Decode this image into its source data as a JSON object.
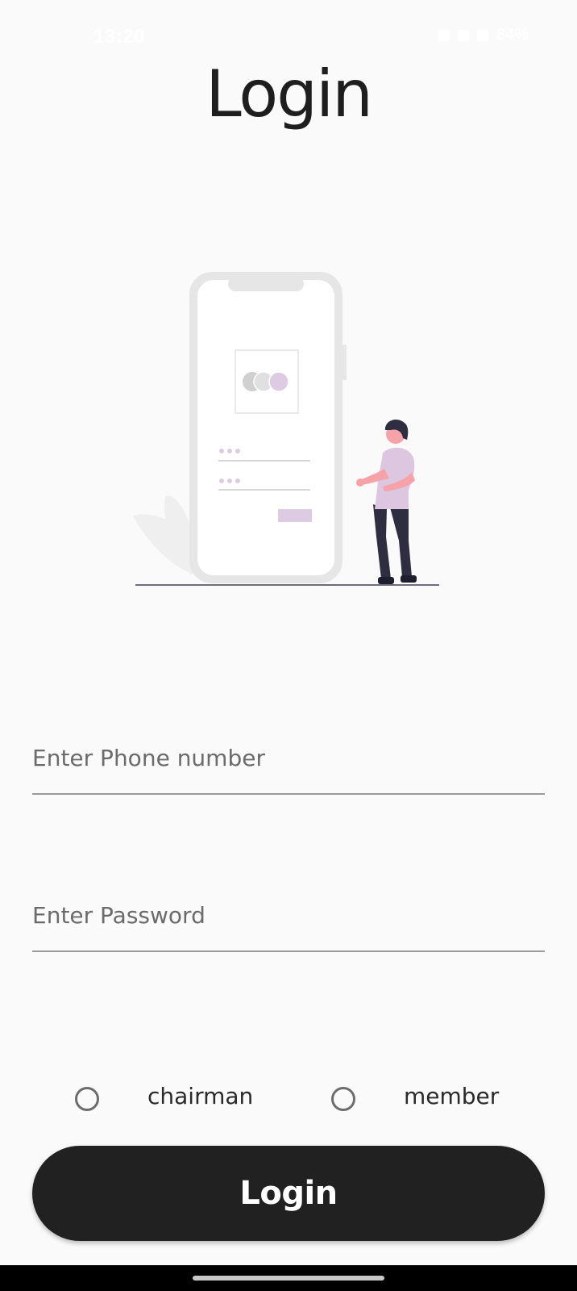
{
  "status_bar": {
    "time": "13:20",
    "battery": "84%"
  },
  "page": {
    "title": "Login"
  },
  "illustration": {
    "accent": "#dccbe2",
    "skin": "#f5a3a8",
    "shirt": "#ddc7e0",
    "pants": "#2f2e41"
  },
  "form": {
    "phone": {
      "value": "",
      "placeholder": "Enter Phone number"
    },
    "password": {
      "value": "",
      "placeholder": "Enter Password"
    },
    "roles": [
      {
        "label": "chairman",
        "checked": false
      },
      {
        "label": "member",
        "checked": false
      }
    ],
    "login_label": "Login"
  },
  "colors": {
    "background": "#fafafa",
    "button": "#212121",
    "text": "#1e1e1e"
  }
}
